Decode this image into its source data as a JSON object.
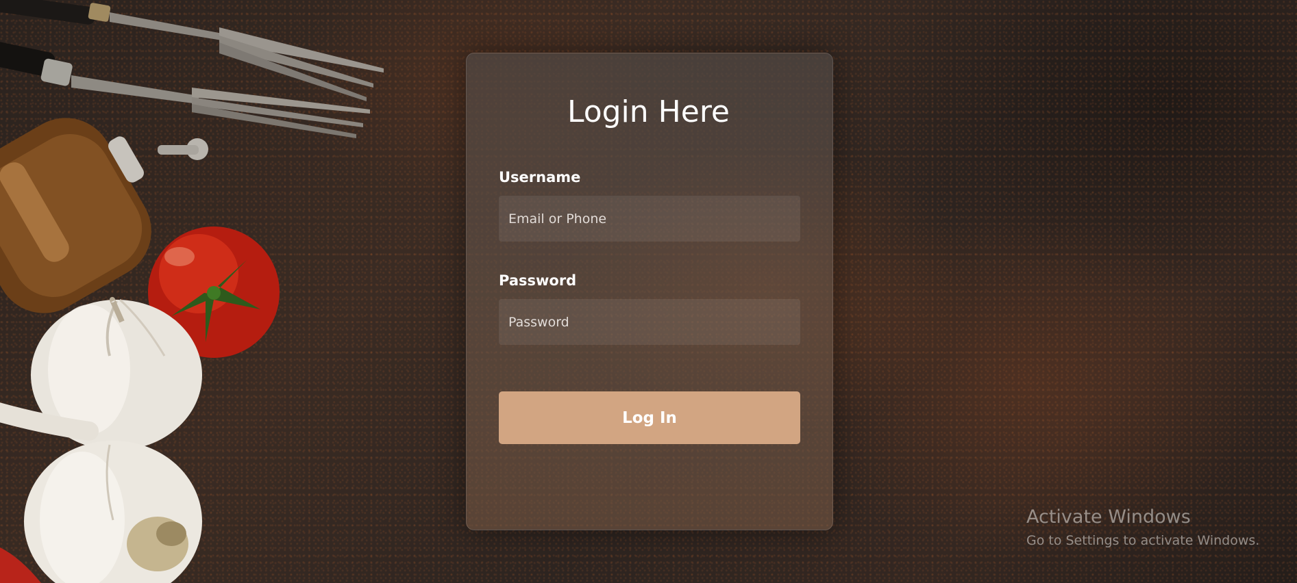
{
  "login": {
    "title": "Login Here",
    "username_label": "Username",
    "username_placeholder": "Email or Phone",
    "password_label": "Password",
    "password_placeholder": "Password",
    "submit_label": "Log In"
  },
  "watermark": {
    "title": "Activate Windows",
    "subtitle": "Go to Settings to activate Windows."
  },
  "colors": {
    "button": "#d2a582",
    "text": "#ffffff"
  },
  "icons": [
    "fork-icon",
    "pepper-mill-icon",
    "tomato-icon",
    "garlic-icon"
  ]
}
